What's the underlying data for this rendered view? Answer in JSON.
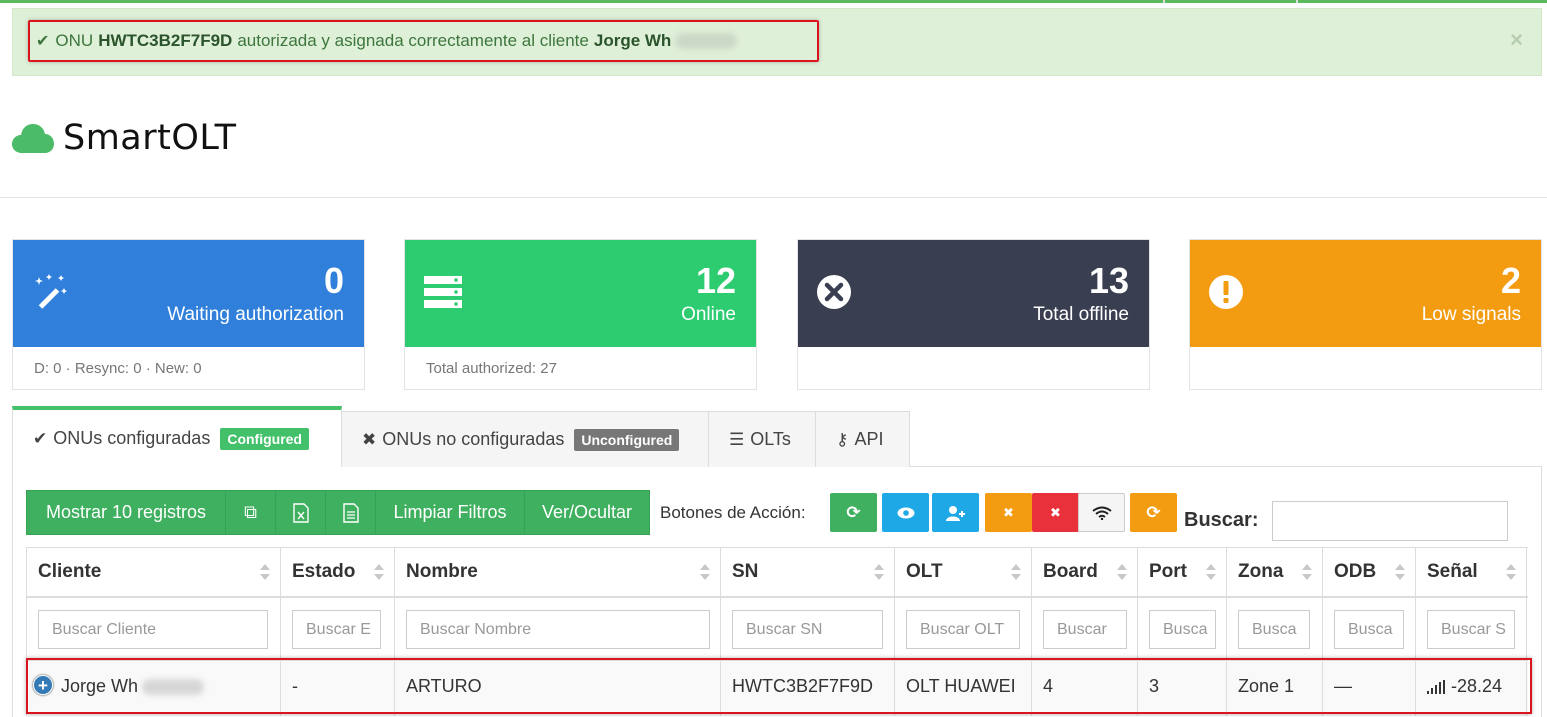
{
  "alert": {
    "prefix": "ONU",
    "sn": "HWTC3B2F7F9D",
    "middle": "autorizada y asignada correctamente al cliente",
    "client": "Jorge Wh",
    "close": "×"
  },
  "brand": {
    "title": "SmartOLT"
  },
  "cards": [
    {
      "value": "0",
      "label": "Waiting authorization",
      "footer": "D: 0 · Resync: 0 · New: 0",
      "color": "#2f7fdb",
      "icon": "magic-wand-icon"
    },
    {
      "value": "12",
      "label": "Online",
      "footer": "Total authorized: 27",
      "color": "#2ecc71",
      "icon": "server-icon"
    },
    {
      "value": "13",
      "label": "Total offline",
      "footer": "",
      "color": "#393e50",
      "icon": "close-circle-icon"
    },
    {
      "value": "2",
      "label": "Low signals",
      "footer": "",
      "color": "#f39c12",
      "icon": "exclamation-circle-icon"
    }
  ],
  "tabs": [
    {
      "label": "ONUs configuradas",
      "badge": "Configured",
      "icon": "check-icon"
    },
    {
      "label": "ONUs no configuradas",
      "badge": "Unconfigured",
      "icon": "times-icon"
    },
    {
      "label": "OLTs",
      "icon": "server-icon"
    },
    {
      "label": "API",
      "icon": "key-icon"
    }
  ],
  "toolbar": {
    "show_records": "Mostrar 10 registros",
    "clear_filters": "Limpiar Filtros",
    "toggle": "Ver/Ocultar",
    "actions_label": "Botones de Acción:",
    "search_label": "Buscar:"
  },
  "table": {
    "columns": [
      "Cliente",
      "Estado",
      "Nombre",
      "SN",
      "OLT",
      "Board",
      "Port",
      "Zona",
      "ODB",
      "Señal"
    ],
    "filters": [
      "Buscar Cliente",
      "Buscar E",
      "Buscar Nombre",
      "Buscar SN",
      "Buscar OLT",
      "Buscar",
      "Busca",
      "Busca",
      "Busca",
      "Buscar S"
    ],
    "rows": [
      {
        "cliente": "Jorge Wh",
        "estado": "-",
        "nombre": "ARTURO",
        "sn": "HWTC3B2F7F9D",
        "olt": "OLT HUAWEI",
        "board": "4",
        "port": "3",
        "zona": "Zone 1",
        "odb": "—",
        "senal": "-28.24"
      }
    ]
  },
  "colors": {
    "primary_green": "#3fb05f",
    "badge_green": "#43c06a",
    "badge_gray": "#777777",
    "highlight_red": "#d9141c"
  }
}
